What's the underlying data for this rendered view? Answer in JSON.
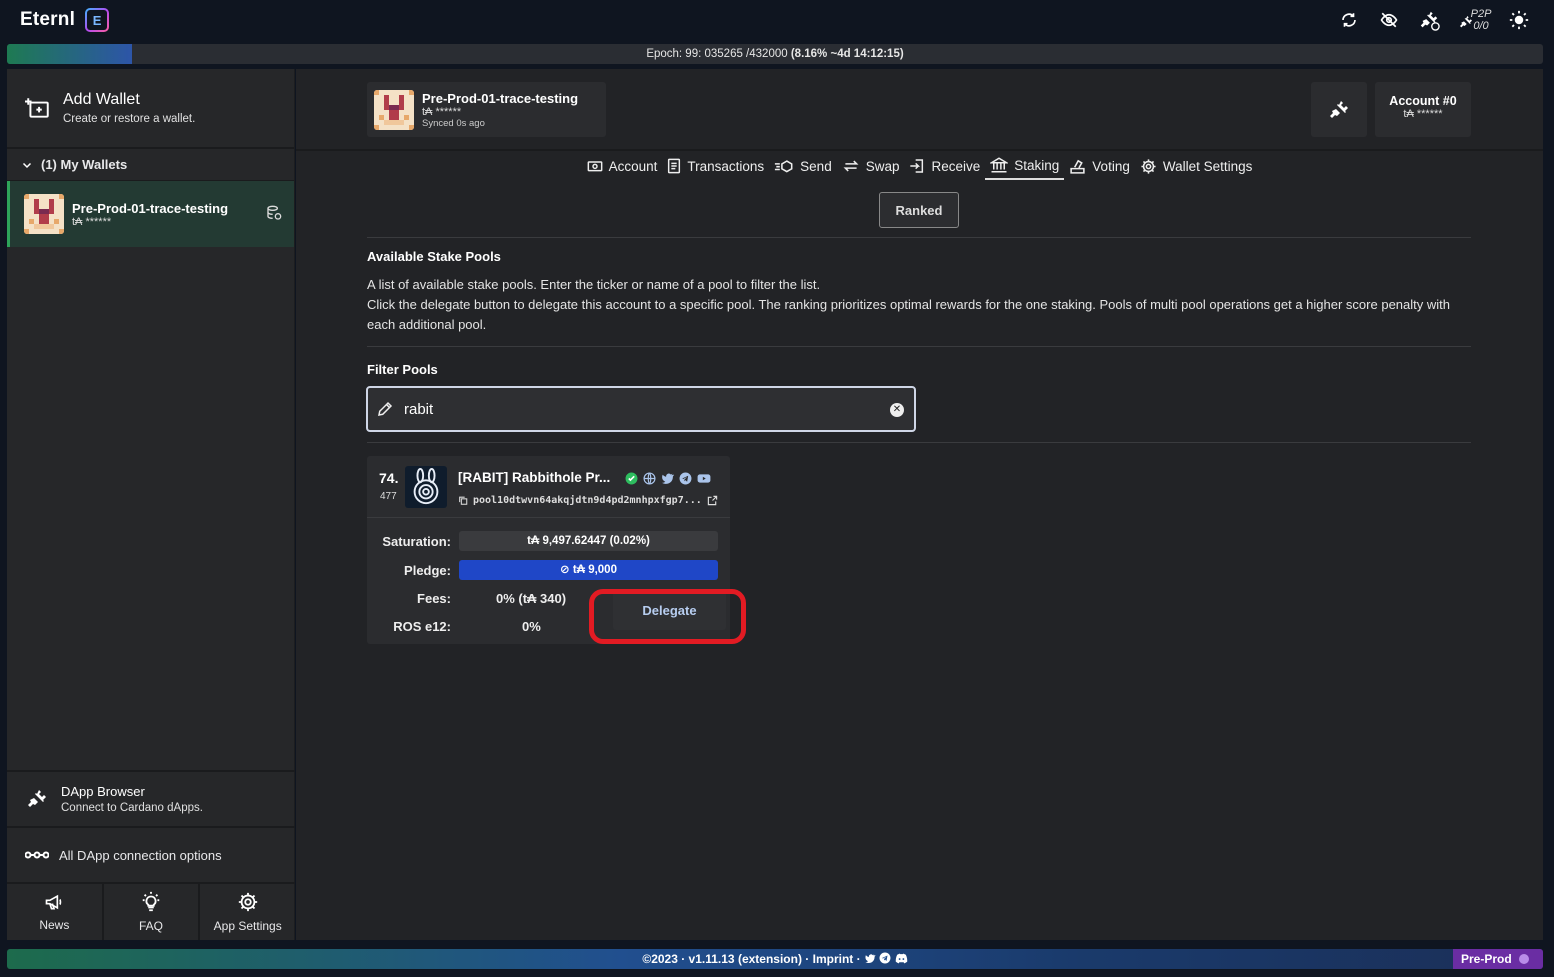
{
  "app": {
    "name": "Eternl",
    "logo_letter": "E"
  },
  "topbar": {
    "p2p_label": "P2P",
    "p2p_count": "0/0"
  },
  "epoch": {
    "prefix": "Epoch: 99: 035265 /432000",
    "detail": "(8.16% ~4d 14:12:15)",
    "progress_pct": 8.16
  },
  "sidebar": {
    "add_wallet": {
      "title": "Add Wallet",
      "subtitle": "Create or restore a wallet."
    },
    "my_wallets_label": "(1) My Wallets",
    "wallets": [
      {
        "name": "Pre-Prod-01-trace-testing",
        "balance": "t₳ ******"
      }
    ],
    "dapp_browser": {
      "title": "DApp Browser",
      "subtitle": "Connect to Cardano dApps."
    },
    "all_dapp": "All DApp connection options",
    "tabs": [
      {
        "label": "News"
      },
      {
        "label": "FAQ"
      },
      {
        "label": "App Settings"
      }
    ]
  },
  "header": {
    "wallet": {
      "name": "Pre-Prod-01-trace-testing",
      "balance": "t₳ ******",
      "synced": "Synced 0s ago"
    },
    "account": {
      "name": "Account #0",
      "balance": "t₳ ******"
    }
  },
  "nav": {
    "items": [
      {
        "label": "Account"
      },
      {
        "label": "Transactions"
      },
      {
        "label": "Send"
      },
      {
        "label": "Swap"
      },
      {
        "label": "Receive"
      },
      {
        "label": "Staking"
      },
      {
        "label": "Voting"
      },
      {
        "label": "Wallet Settings"
      }
    ],
    "active": "Staking"
  },
  "staking": {
    "ranked_label": "Ranked",
    "available_title": "Available Stake Pools",
    "description_1": "A list of available stake pools. Enter the ticker or name of a pool to filter the list.",
    "description_2": "Click the delegate button to delegate this account to a specific pool. The ranking prioritizes optimal rewards for the one staking. Pools of multi pool operations get a higher score penalty with each additional pool.",
    "filter_title": "Filter Pools",
    "filter_value": "rabit"
  },
  "pool": {
    "rank": "74.",
    "rank_sub": "477",
    "name": "[RABIT] Rabbithole Pr...",
    "pool_id": "pool10dtwvn64akqjdtn9d4pd2mnhpxfgp7...",
    "saturation_label": "Saturation:",
    "saturation_value": "t₳ 9,497.62447 (0.02%)",
    "pledge_label": "Pledge:",
    "pledge_value": "t₳ 9,000",
    "fees_label": "Fees:",
    "fees_value": "0% (t₳ 340)",
    "ros_label": "ROS e12:",
    "ros_value": "0%",
    "delegate_label": "Delegate"
  },
  "footer": {
    "text": "©2023 · v1.11.13 (extension) · Imprint ·",
    "network": "Pre-Prod"
  }
}
